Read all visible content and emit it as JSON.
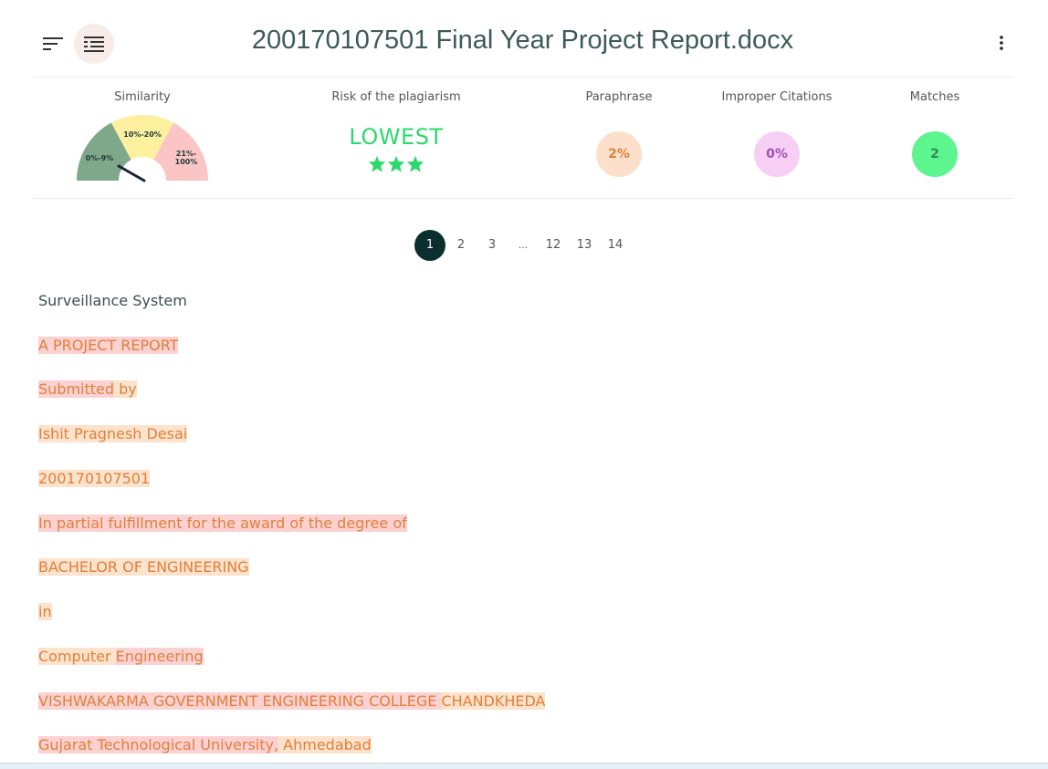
{
  "header": {
    "title": "200170107501 Final Year Project Report.docx"
  },
  "stats": {
    "similarity": {
      "label": "Similarity",
      "ranges": [
        "0%-9%",
        "10%-20%",
        "21%-",
        "100%"
      ],
      "colors": [
        "#7fa88a",
        "#fdf1a0",
        "#fcc5c5"
      ]
    },
    "risk": {
      "label": "Risk of the plagiarism",
      "value": "LOWEST",
      "stars": 3,
      "color": "#2bd96b"
    },
    "paraphrase": {
      "label": "Paraphrase",
      "value": "2%",
      "bg": "#fde0cb",
      "fg": "#e0803a"
    },
    "improper_citations": {
      "label": "Improper Citations",
      "value": "0%",
      "bg": "#f7cff5",
      "fg": "#a050b0"
    },
    "matches": {
      "label": "Matches",
      "value": "2",
      "bg": "#5cf58e",
      "fg": "#2e8a58"
    }
  },
  "pagination": {
    "pages": [
      "1",
      "2",
      "3",
      "...",
      "12",
      "13",
      "14"
    ],
    "active": "1"
  },
  "document": {
    "lines": [
      {
        "segments": [
          {
            "text": "Surveillance System",
            "style": "plain"
          }
        ]
      },
      {
        "segments": [
          {
            "text": "A PROJECT REPORT",
            "style": "red"
          }
        ]
      },
      {
        "segments": [
          {
            "text": "Submitted",
            "style": "red"
          },
          {
            "text": " by",
            "style": "peach"
          }
        ]
      },
      {
        "segments": [
          {
            "text": "Ishit Pragnesh Desai",
            "style": "peach"
          }
        ]
      },
      {
        "segments": [
          {
            "text": "200170107501",
            "style": "peach"
          }
        ]
      },
      {
        "segments": [
          {
            "text": "In partial fulfillment for the award of the degree of",
            "style": "red"
          }
        ]
      },
      {
        "segments": [
          {
            "text": "BACHELOR OF ENGINEERING",
            "style": "peach"
          }
        ]
      },
      {
        "segments": [
          {
            "text": "in",
            "style": "peach"
          }
        ]
      },
      {
        "segments": [
          {
            "text": "Computer ",
            "style": "peach"
          },
          {
            "text": "Engineering",
            "style": "red"
          }
        ]
      },
      {
        "segments": [
          {
            "text": "VISHWAKARMA GOVERNMENT ENGINEERING COLLEGE ",
            "style": "red"
          },
          {
            "text": "CHANDKHEDA",
            "style": "peach"
          }
        ]
      },
      {
        "segments": [
          {
            "text": "Gujarat Technological University,",
            "style": "red"
          },
          {
            "text": " Ahmedabad",
            "style": "peach"
          }
        ]
      }
    ]
  }
}
